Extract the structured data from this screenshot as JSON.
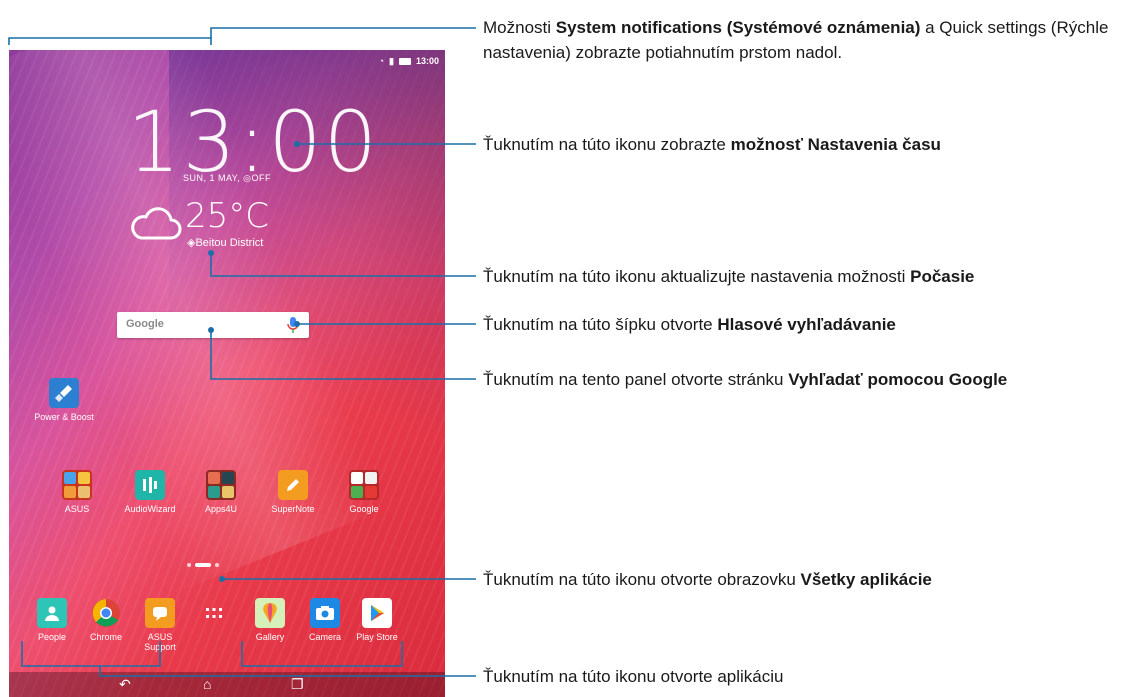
{
  "status": {
    "time": "13:00"
  },
  "clock": {
    "time": "13:00",
    "date": "SUN, 1 MAY, ◎OFF"
  },
  "weather": {
    "temperature": "25°C",
    "location": "◈Beitou District"
  },
  "search": {
    "logo": "Google"
  },
  "apps": [
    {
      "label": "Power & Boost",
      "icon": "broom-icon"
    },
    {
      "label": "ASUS",
      "icon": "folder-icon"
    },
    {
      "label": "AudioWizard",
      "icon": "equalizer-icon"
    },
    {
      "label": "Apps4U",
      "icon": "folder-icon"
    },
    {
      "label": "SuperNote",
      "icon": "pen-icon"
    },
    {
      "label": "Google",
      "icon": "folder-icon"
    }
  ],
  "dock": [
    {
      "label": "People",
      "icon": "contact-icon"
    },
    {
      "label": "Chrome",
      "icon": "chrome-icon"
    },
    {
      "label": "ASUS\nSupport",
      "icon": "support-icon"
    },
    {
      "label": "",
      "icon": "all-apps-icon"
    },
    {
      "label": "Gallery",
      "icon": "gallery-icon"
    },
    {
      "label": "Camera",
      "icon": "camera-icon"
    },
    {
      "label": "Play Store",
      "icon": "play-store-icon"
    }
  ],
  "nav": {
    "back": "back-icon",
    "home": "home-icon",
    "recent": "recent-apps-icon"
  },
  "callouts": {
    "c1": {
      "t1": "Možnosti ",
      "b1": "System notifications (Systémové oznámenia)",
      "t2": " a Quick settings (Rýchle nastavenia) zobrazte potiahnutím prstom nadol."
    },
    "c2": {
      "t1": "Ťuknutím na túto ikonu zobrazte ",
      "b1": "možnosť Nastavenia času"
    },
    "c3": {
      "t1": "Ťuknutím na túto ikonu aktualizujte nastavenia možnosti ",
      "b1": "Počasie"
    },
    "c4": {
      "t1": "Ťuknutím na túto šípku otvorte ",
      "b1": "Hlasové vyhľadávanie"
    },
    "c5": {
      "t1": "Ťuknutím na tento panel otvorte stránku ",
      "b1": "Vyhľadať pomocou Google"
    },
    "c6": {
      "t1": "Ťuknutím na túto ikonu otvorte obrazovku ",
      "b1": "Všetky aplikácie"
    },
    "c7": {
      "t1": "Ťuknutím na túto ikonu otvorte aplikáciu"
    }
  },
  "colors": {
    "line": "#1b6fa8",
    "accent_orange": "#f39c1f",
    "accent_teal": "#1fb5a8"
  }
}
